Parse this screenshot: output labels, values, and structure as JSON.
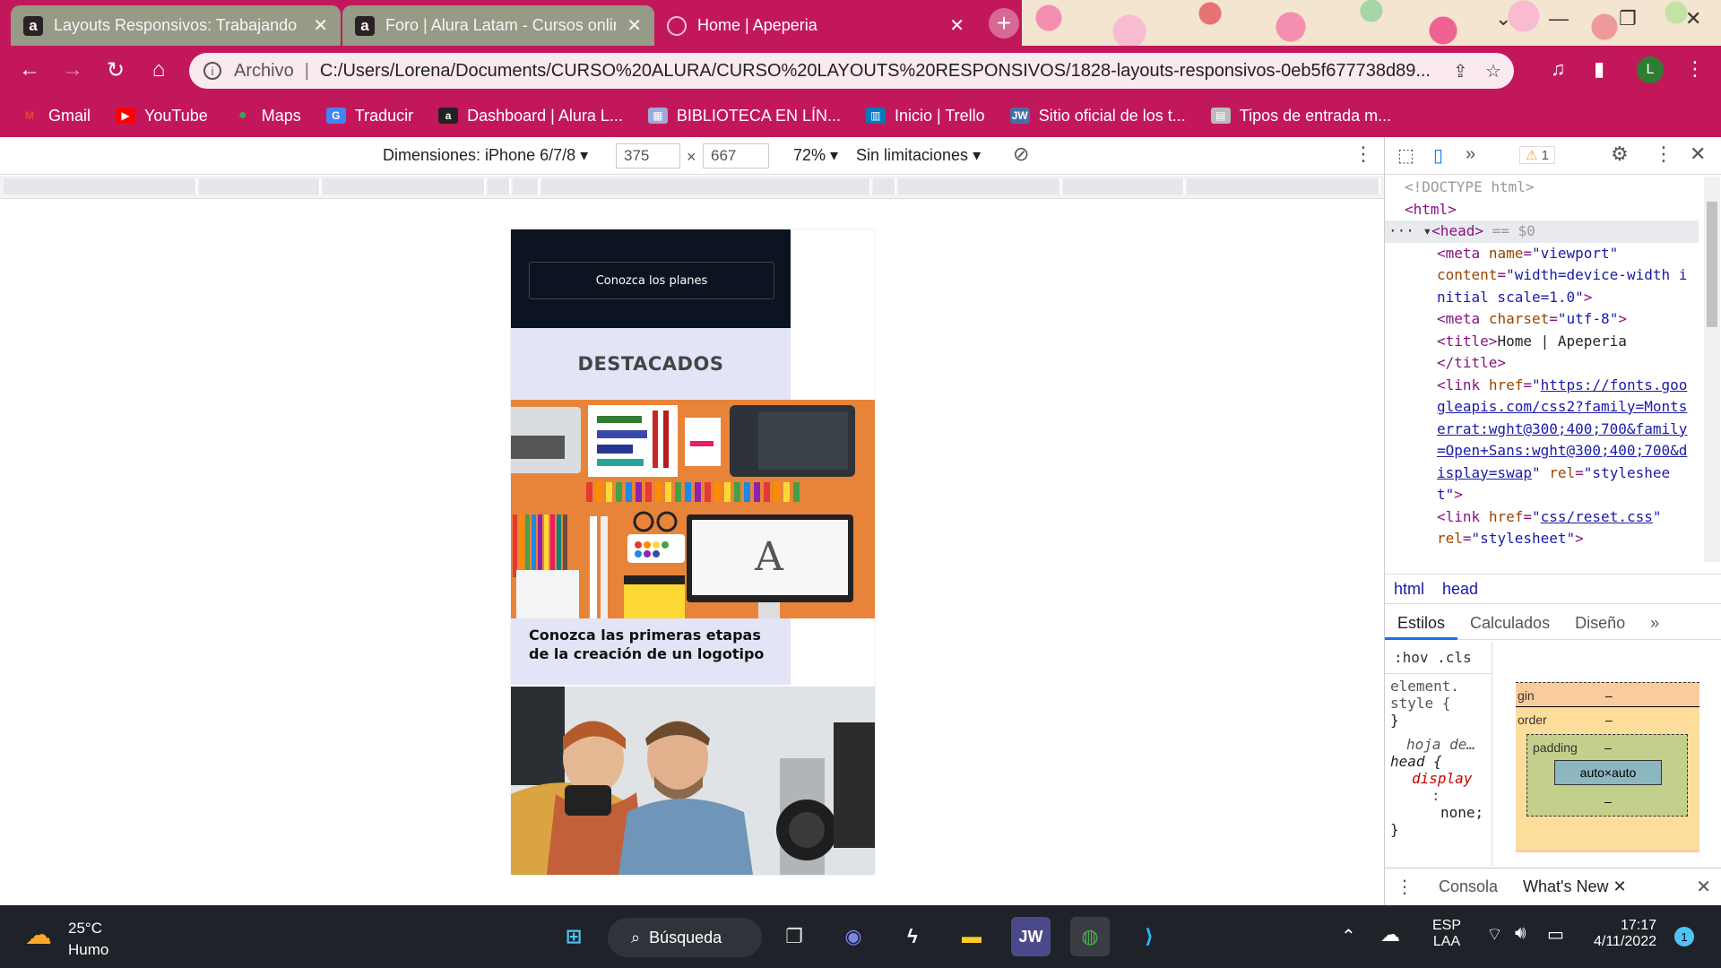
{
  "tabs": [
    {
      "title": "Layouts Responsivos: Trabajando con diseño",
      "favicon": "a",
      "active": false
    },
    {
      "title": "Foro | Alura Latam - Cursos online",
      "favicon": "a",
      "active": false
    },
    {
      "title": "Home | Apeperia",
      "favicon": "globe",
      "active": true
    }
  ],
  "omnibox": {
    "scheme": "Archivo",
    "url": "C:/Users/Lorena/Documents/CURSO%20ALURA/CURSO%20LAYOUTS%20RESPONSIVOS/1828-layouts-responsivos-0eb5f677738d89..."
  },
  "profile_initial": "L",
  "bookmarks": [
    "Gmail",
    "YouTube",
    "Maps",
    "Traducir",
    "Dashboard | Alura L...",
    "BIBLIOTECA EN LÍN...",
    "Inicio | Trello",
    "Sitio oficial de los t...",
    "Tipos de entrada m..."
  ],
  "devtoolbar": {
    "dimensions_label": "Dimensiones: iPhone 6/7/8",
    "width": "375",
    "height": "667",
    "times": "×",
    "zoom": "72%",
    "throttle": "Sin limitaciones"
  },
  "page": {
    "cta": "Conozca los planes",
    "section_title": "DESTACADOS",
    "card1_caption": "Conozca las primeras etapas de la creación de un logotipo"
  },
  "devtools": {
    "warning_count": "1",
    "breadcrumbs": [
      "html",
      "head"
    ],
    "style_tabs": [
      "Estilos",
      "Calculados",
      "Diseño"
    ],
    "filter_chips": [
      ":hov",
      ".cls"
    ],
    "drawer": [
      "Consola",
      "What's New"
    ],
    "boxmodel": {
      "margin": "gin",
      "border": "order",
      "padding": "padding",
      "content": "auto×auto",
      "dash": "–"
    },
    "styles": [
      "element.",
      "style {",
      "}",
      "hoja de…",
      "head {",
      "display",
      ":",
      "none;",
      "}"
    ]
  },
  "taskbar": {
    "weather_temp": "25°C",
    "weather_desc": "Humo",
    "search": "Búsqueda",
    "lang1": "ESP",
    "lang2": "LAA",
    "time": "17:17",
    "date": "4/11/2022",
    "notif": "1"
  }
}
